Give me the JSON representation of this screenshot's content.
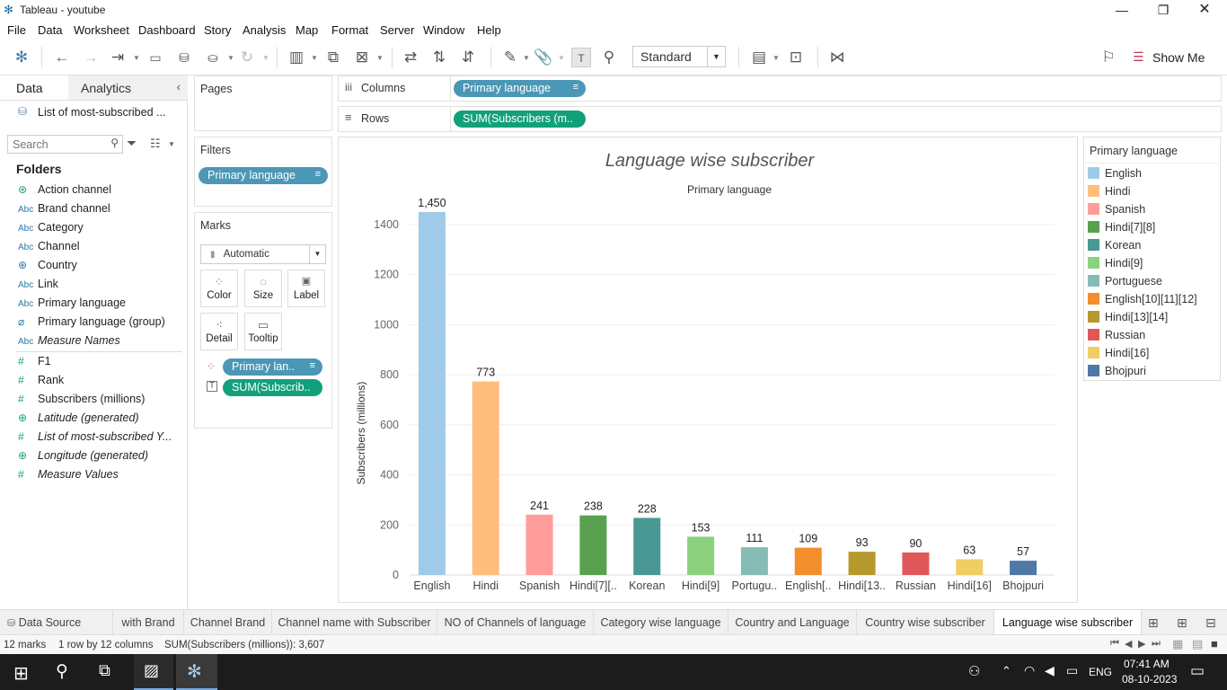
{
  "window": {
    "title": "Tableau - youtube"
  },
  "menu": [
    "File",
    "Data",
    "Worksheet",
    "Dashboard",
    "Story",
    "Analysis",
    "Map",
    "Format",
    "Server",
    "Window",
    "Help"
  ],
  "toolbar": {
    "fit_value": "Standard",
    "show_me": "Show Me"
  },
  "data_pane": {
    "tab_data": "Data",
    "tab_analytics": "Analytics",
    "datasource": "List of most-subscribed ...",
    "search_placeholder": "Search",
    "folders_heading": "Folders",
    "fields": [
      {
        "label": "Action channel",
        "type": "geo",
        "italic": false
      },
      {
        "label": "Brand channel",
        "type": "Abc",
        "italic": false
      },
      {
        "label": "Category",
        "type": "Abc",
        "italic": false
      },
      {
        "label": "Channel",
        "type": "Abc",
        "italic": false
      },
      {
        "label": "Country",
        "type": "globe",
        "italic": false
      },
      {
        "label": "Link",
        "type": "Abc",
        "italic": false
      },
      {
        "label": "Primary language",
        "type": "Abc",
        "italic": false
      },
      {
        "label": "Primary language (group)",
        "type": "clip",
        "italic": false
      },
      {
        "label": "Measure Names",
        "type": "Abc",
        "italic": true
      },
      {
        "label": "F1",
        "type": "#",
        "italic": false
      },
      {
        "label": "Rank",
        "type": "#",
        "italic": false
      },
      {
        "label": "Subscribers (millions)",
        "type": "#",
        "italic": false
      },
      {
        "label": "Latitude (generated)",
        "type": "globe",
        "italic": true
      },
      {
        "label": "List of most-subscribed Y...",
        "type": "#",
        "italic": true
      },
      {
        "label": "Longitude (generated)",
        "type": "globe",
        "italic": true
      },
      {
        "label": "Measure Values",
        "type": "#",
        "italic": true
      }
    ]
  },
  "shelves": {
    "pages": "Pages",
    "filters": "Filters",
    "filter_pill": "Primary language",
    "marks": "Marks",
    "mark_type": "Automatic",
    "mark_buttons": [
      "Color",
      "Size",
      "Label",
      "Detail",
      "Tooltip"
    ],
    "marks_pill_color": "Primary lan..",
    "marks_pill_label": "SUM(Subscrib..",
    "columns_label": "Columns",
    "columns_pill": "Primary language",
    "rows_label": "Rows",
    "rows_pill": "SUM(Subscribers (m.."
  },
  "chart_data": {
    "type": "bar",
    "title": "Language wise subscriber",
    "xlabel": "Primary language",
    "ylabel": "Subscribers (millions)",
    "ylim": [
      0,
      1500
    ],
    "yticks": [
      0,
      200,
      400,
      600,
      800,
      1000,
      1200,
      1400
    ],
    "grid": true,
    "categories": [
      "English",
      "Hindi",
      "Spanish",
      "Hindi[7][8]",
      "Korean",
      "Hindi[9]",
      "Portuguese",
      "English[10][11][12]",
      "Hindi[13][14]",
      "Russian",
      "Hindi[16]",
      "Bhojpuri"
    ],
    "tick_labels": [
      "English",
      "Hindi",
      "Spanish",
      "Hindi[7][..",
      "Korean",
      "Hindi[9]",
      "Portugu..",
      "English[..",
      "Hindi[13..",
      "Russian",
      "Hindi[16]",
      "Bhojpuri"
    ],
    "values": [
      1450,
      773,
      241,
      238,
      228,
      153,
      111,
      109,
      93,
      90,
      63,
      57
    ],
    "value_labels": [
      "1,450",
      "773",
      "241",
      "238",
      "228",
      "153",
      "111",
      "109",
      "93",
      "90",
      "63",
      "57"
    ],
    "colors": [
      "#a0cbe8",
      "#ffbe7d",
      "#ff9d9a",
      "#59a14f",
      "#499894",
      "#8cd17d",
      "#86bcb6",
      "#f28e2b",
      "#b6992d",
      "#e15759",
      "#f1ce63",
      "#4e79a7"
    ]
  },
  "legend": {
    "title": "Primary language",
    "items": [
      "English",
      "Hindi",
      "Spanish",
      "Hindi[7][8]",
      "Korean",
      "Hindi[9]",
      "Portuguese",
      "English[10][11][12]",
      "Hindi[13][14]",
      "Russian",
      "Hindi[16]",
      "Bhojpuri"
    ]
  },
  "sheet_tabs": {
    "datasource": "Data Source",
    "tabs": [
      "with Brand",
      "Channel Brand",
      "Channel name with Subscriber",
      "NO of Channels of language",
      "Category wise language",
      "Country and Language",
      "Country wise subscriber",
      "Language wise subscriber"
    ],
    "active": "Language wise subscriber"
  },
  "status": {
    "marks": "12 marks",
    "dims": "1 row by 12 columns",
    "sum": "SUM(Subscribers (millions)): 3,607"
  },
  "taskbar": {
    "time": "07:41 AM",
    "date": "08-10-2023",
    "lang": "ENG"
  }
}
